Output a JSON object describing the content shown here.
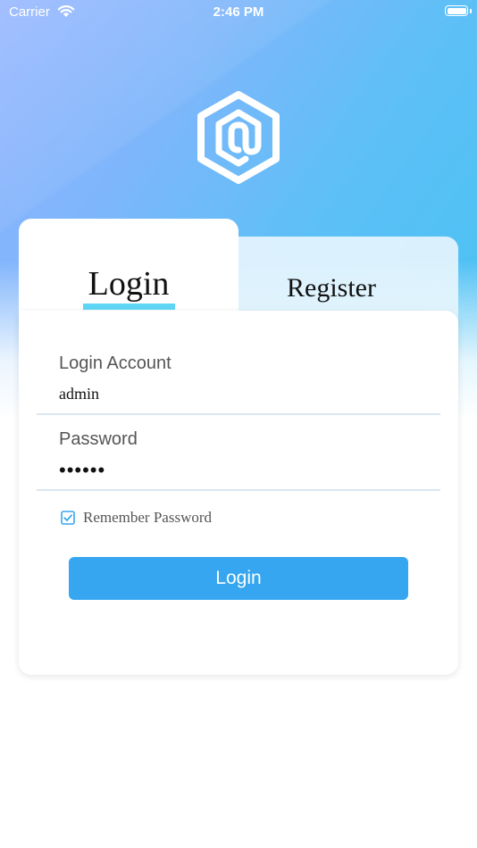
{
  "status_bar": {
    "carrier": "Carrier",
    "time": "2:46 PM"
  },
  "tabs": [
    {
      "label": "Login",
      "active": true
    },
    {
      "label": "Register",
      "active": false
    }
  ],
  "form": {
    "account_label": "Login Account",
    "account_value": "admin",
    "password_label": "Password",
    "password_value": "••••••",
    "remember_label": "Remember Password",
    "remember_checked": true,
    "submit_label": "Login"
  },
  "colors": {
    "accent": "#35a6ef",
    "tab_underline": "#5fd6f5",
    "gradient_start": "#8fb1ff",
    "gradient_end": "#49c2f3"
  },
  "icons": {
    "logo": "hexagon-at-logo-icon",
    "wifi": "wifi-icon",
    "battery": "battery-icon",
    "checkbox": "checkbox-checked-icon"
  }
}
